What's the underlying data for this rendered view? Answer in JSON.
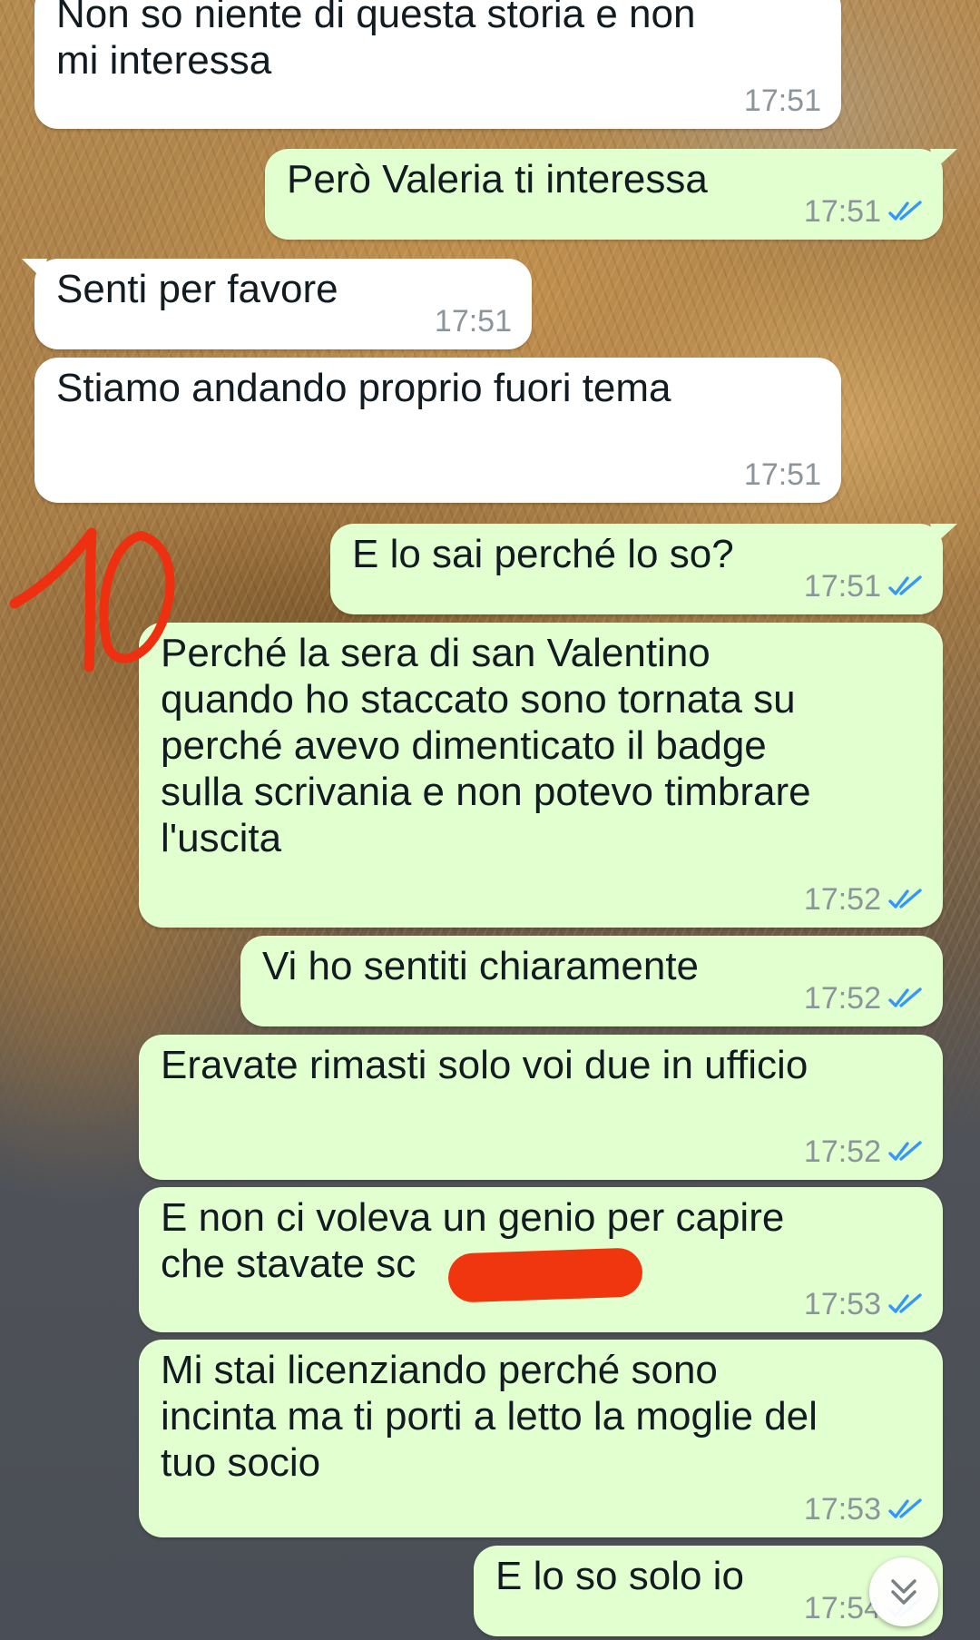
{
  "messages": [
    {
      "text": "Non so niente di questa storia e non\nmi interessa",
      "time": "17:51",
      "direction": "in",
      "ticks": ""
    },
    {
      "text": "Però Valeria ti interessa",
      "time": "17:51",
      "direction": "out",
      "ticks": "read"
    },
    {
      "text": "Senti per favore",
      "time": "17:51",
      "direction": "in",
      "ticks": ""
    },
    {
      "text": "Stiamo andando proprio fuori tema",
      "time": "17:51",
      "direction": "in",
      "ticks": ""
    },
    {
      "text": "E lo sai perché lo so?",
      "time": "17:51",
      "direction": "out",
      "ticks": "read"
    },
    {
      "text": "Perché la sera di san Valentino\nquando ho staccato sono tornata su\nperché avevo dimenticato il badge\nsulla scrivania e non potevo timbrare\nl'uscita",
      "time": "17:52",
      "direction": "out",
      "ticks": "read"
    },
    {
      "text": "Vi ho sentiti chiaramente",
      "time": "17:52",
      "direction": "out",
      "ticks": "read"
    },
    {
      "text": "Eravate rimasti solo voi due in ufficio",
      "time": "17:52",
      "direction": "out",
      "ticks": "read"
    },
    {
      "text": "E non ci voleva un genio per capire\nche stavate sc",
      "time": "17:53",
      "direction": "out",
      "ticks": "read"
    },
    {
      "text": "Mi stai licenziando perché sono\nincinta ma ti porti a letto la moglie del\ntuo socio",
      "time": "17:53",
      "direction": "out",
      "ticks": "read"
    },
    {
      "text": "E lo so solo io",
      "time": "17:54",
      "direction": "out",
      "ticks": "read"
    }
  ],
  "overlay": {
    "scribble_icon": "handwritten-number-10",
    "redaction_color": "#f0360f",
    "scroll_button_icon": "double-chevron-down-icon"
  },
  "colors": {
    "incoming_bubble": "#ffffff",
    "outgoing_bubble": "#e2ffd0",
    "read_ticks": "#3497f9",
    "timestamp": "#8c959b"
  }
}
